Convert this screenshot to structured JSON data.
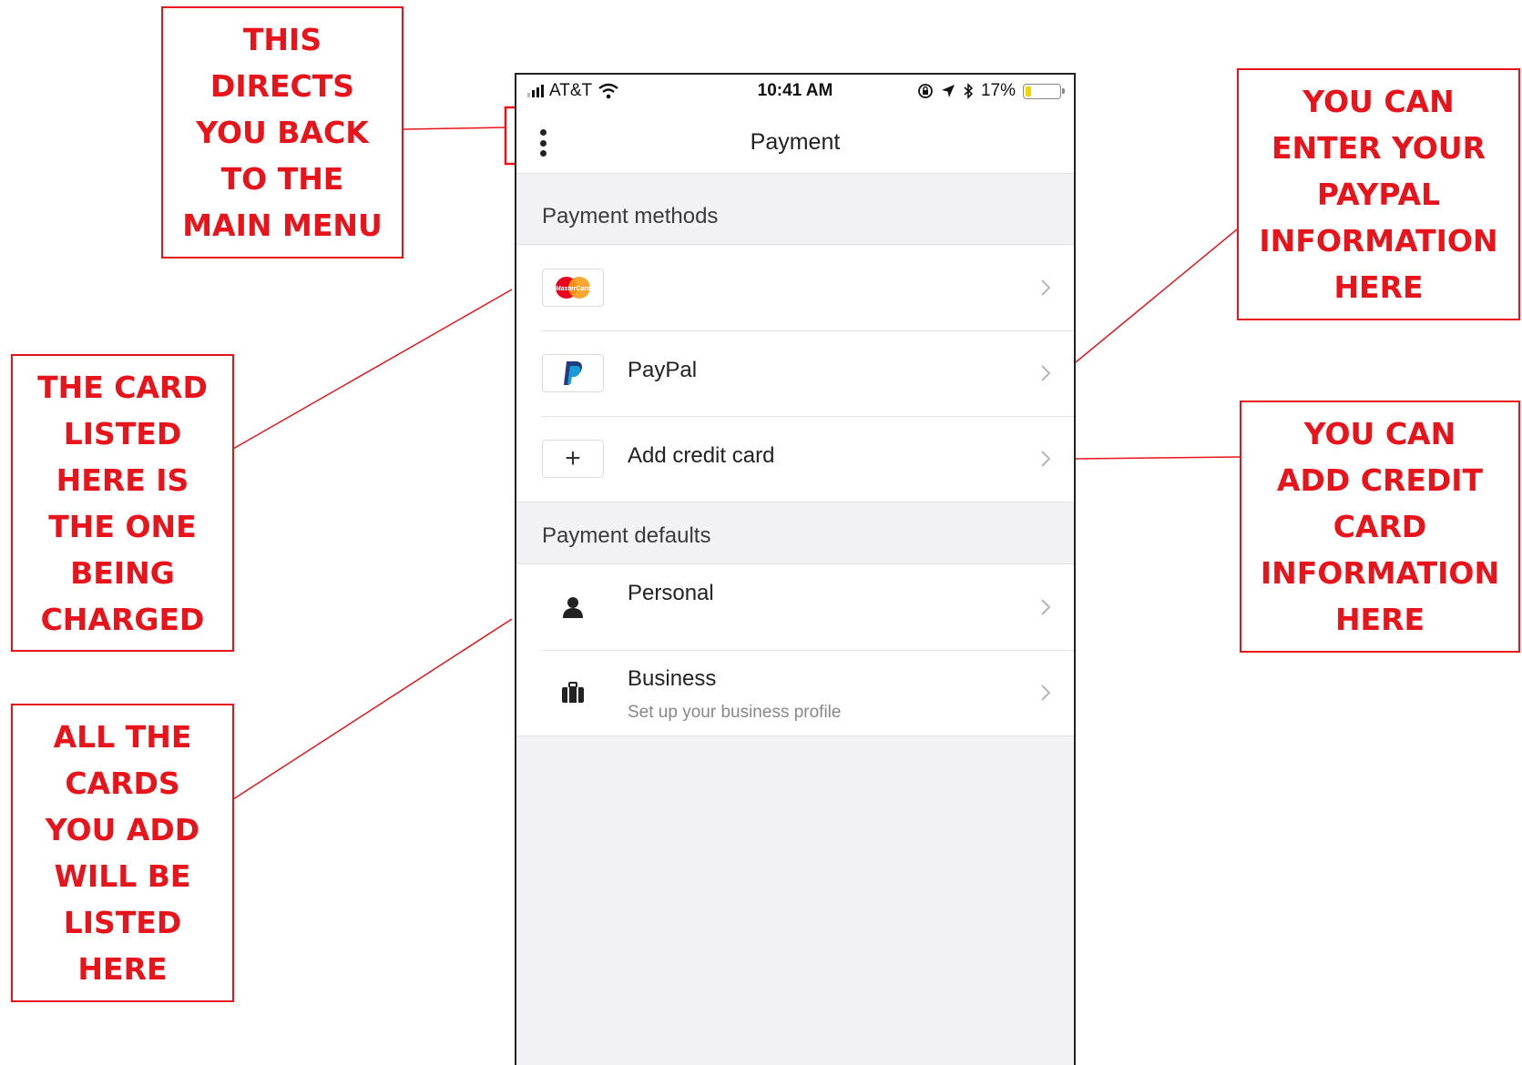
{
  "status_bar": {
    "carrier": "AT&T",
    "time": "10:41 AM",
    "battery_percent": "17%",
    "battery_level": 0.17
  },
  "nav": {
    "title": "Payment",
    "menu_icon": "more-vertical-icon"
  },
  "payment_methods": {
    "header": "Payment methods",
    "items": [
      {
        "label": "",
        "icon": "mastercard-icon",
        "card_brand_text": "MasterCard"
      },
      {
        "label": "PayPal",
        "icon": "paypal-icon"
      },
      {
        "label": "Add credit card",
        "icon": "plus-icon"
      }
    ]
  },
  "payment_defaults": {
    "header": "Payment defaults",
    "items": [
      {
        "label": "Personal",
        "icon": "person-icon"
      },
      {
        "label": "Business",
        "subtitle": "Set up your business profile",
        "icon": "briefcase-icon"
      }
    ]
  },
  "annotations": {
    "back_to_menu": [
      "THIS",
      "DIRECTS",
      "YOU BACK",
      "TO THE",
      "MAIN MENU"
    ],
    "paypal": [
      "YOU CAN",
      "ENTER YOUR",
      "PAYPAL",
      "INFORMATION",
      "HERE"
    ],
    "card_charged": [
      "THE CARD",
      "LISTED",
      "HERE IS",
      "THE ONE",
      "BEING",
      "CHARGED"
    ],
    "add_credit_card": [
      "YOU CAN",
      "ADD CREDIT",
      "CARD",
      "INFORMATION",
      "HERE"
    ],
    "all_cards": [
      "ALL THE",
      "CARDS",
      "YOU ADD",
      "WILL BE",
      "LISTED",
      "HERE"
    ]
  },
  "colors": {
    "annotation_red": "#e8141b",
    "paypal_dark": "#253b80",
    "paypal_light": "#179bd7",
    "mastercard_red": "#eb001b",
    "mastercard_orange": "#f79e1b",
    "battery_yellow": "#f5d200"
  }
}
